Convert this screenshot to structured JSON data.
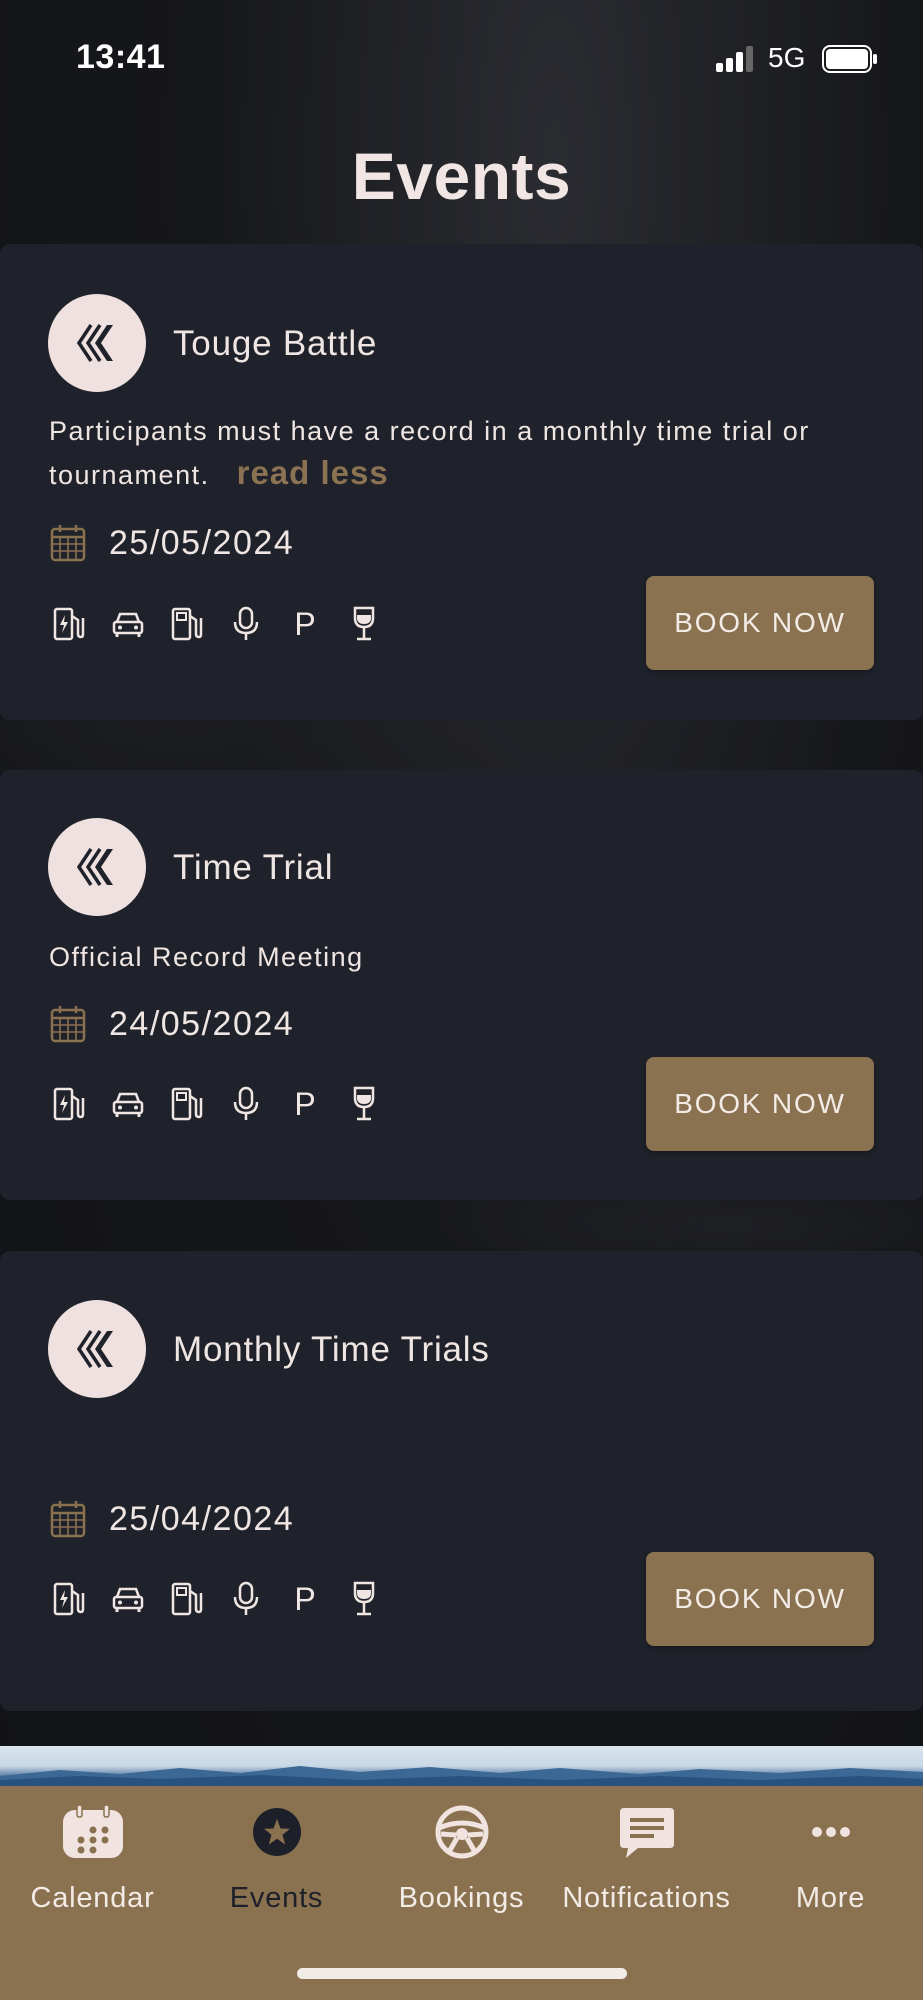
{
  "status_bar": {
    "time": "13:41",
    "network": "5G"
  },
  "page": {
    "title": "Events"
  },
  "events": [
    {
      "name": "Touge Battle",
      "description": "Participants must have a record in a monthly time trial or tournament.",
      "toggle_label": "read less",
      "date": "25/05/2024",
      "book_label": "BOOK NOW",
      "amenity_icons": [
        "ev-charging-icon",
        "car-icon",
        "fuel-pump-icon",
        "microphone-icon",
        "parking-icon",
        "wine-glass-icon"
      ]
    },
    {
      "name": "Time Trial",
      "description": "Official Record Meeting",
      "date": "24/05/2024",
      "book_label": "BOOK NOW",
      "amenity_icons": [
        "ev-charging-icon",
        "car-icon",
        "fuel-pump-icon",
        "microphone-icon",
        "parking-icon",
        "wine-glass-icon"
      ]
    },
    {
      "name": "Monthly Time Trials",
      "description": "",
      "date": "25/04/2024",
      "book_label": "BOOK NOW",
      "amenity_icons": [
        "ev-charging-icon",
        "car-icon",
        "fuel-pump-icon",
        "microphone-icon",
        "parking-icon",
        "wine-glass-icon"
      ]
    }
  ],
  "amenity_parking_label": "P",
  "tab_bar": {
    "active": "Events",
    "tabs": [
      {
        "label": "Calendar",
        "icon": "calendar-icon"
      },
      {
        "label": "Events",
        "icon": "star-icon"
      },
      {
        "label": "Bookings",
        "icon": "steering-wheel-icon"
      },
      {
        "label": "Notifications",
        "icon": "chat-icon"
      },
      {
        "label": "More",
        "icon": "more-icon"
      }
    ]
  },
  "colors": {
    "accent": "#8a7250",
    "card": "#20222b",
    "text": "#efe6e3",
    "logo_bg": "#eee1df"
  }
}
